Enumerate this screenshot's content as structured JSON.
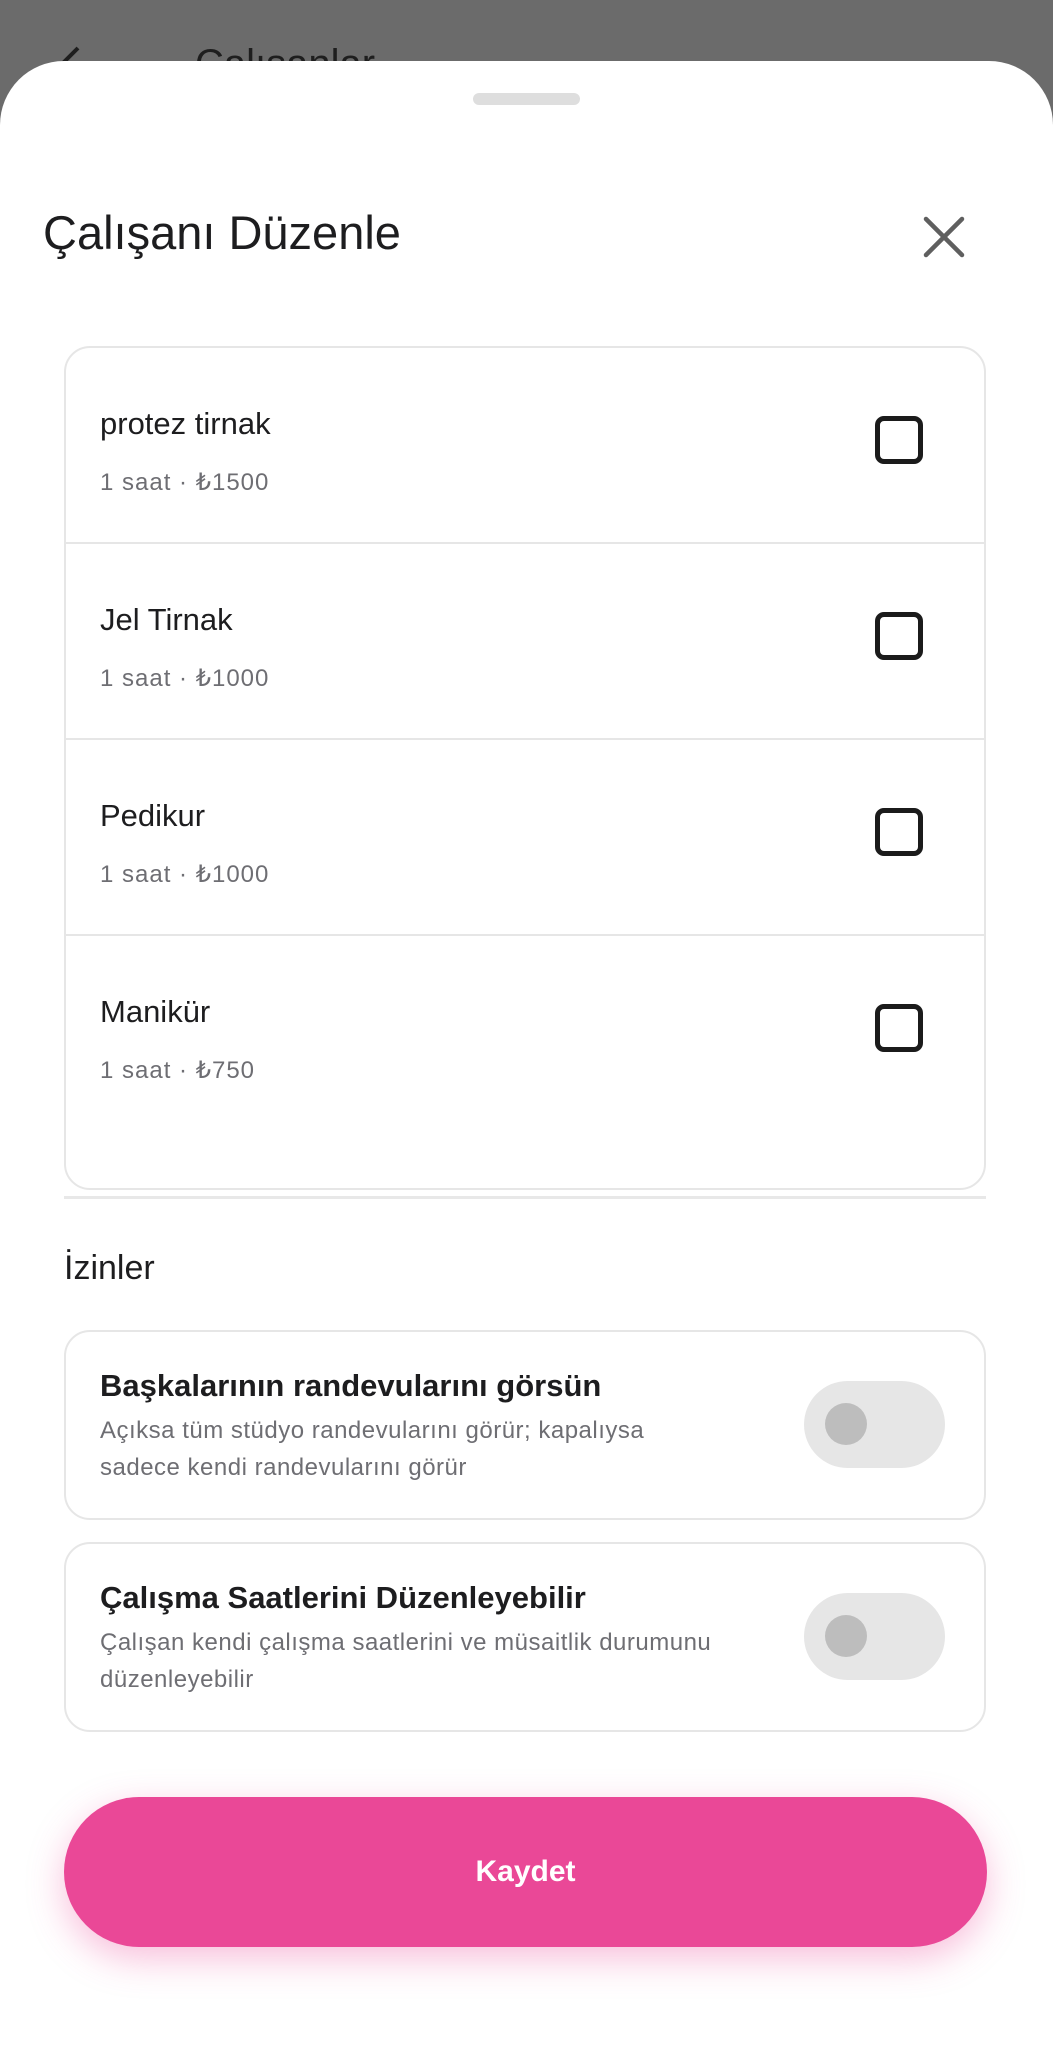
{
  "backdrop": {
    "title": "Çalışanlar",
    "back_icon": "arrow-back-icon"
  },
  "sheet": {
    "title": "Çalışanı Düzenle",
    "close_icon": "close-icon"
  },
  "services": [
    {
      "name": "protez tirnak",
      "meta": "1 saat · ₺1500",
      "checked": false
    },
    {
      "name": "Jel Tirnak",
      "meta": "1 saat · ₺1000",
      "checked": false
    },
    {
      "name": "Pedikur",
      "meta": "1 saat · ₺1000",
      "checked": false
    },
    {
      "name": "Manikür",
      "meta": "1 saat · ₺750",
      "checked": false
    }
  ],
  "permissions": {
    "heading": "İzinler",
    "items": [
      {
        "title": "Başkalarının randevularını görsün",
        "description": "Açıksa tüm stüdyo randevularını görür; kapalıysa sadece kendi randevularını görür",
        "enabled": false
      },
      {
        "title": "Çalışma Saatlerini Düzenleyebilir",
        "description": "Çalışan kendi çalışma saatlerini ve müsaitlik durumunu düzenleyebilir",
        "enabled": false
      }
    ]
  },
  "save_button": {
    "label": "Kaydet"
  },
  "colors": {
    "accent": "#ea4897",
    "border": "#e6e6e6",
    "toggle_off_track": "#e6e6e6",
    "toggle_off_knob": "#bdbdbd"
  }
}
